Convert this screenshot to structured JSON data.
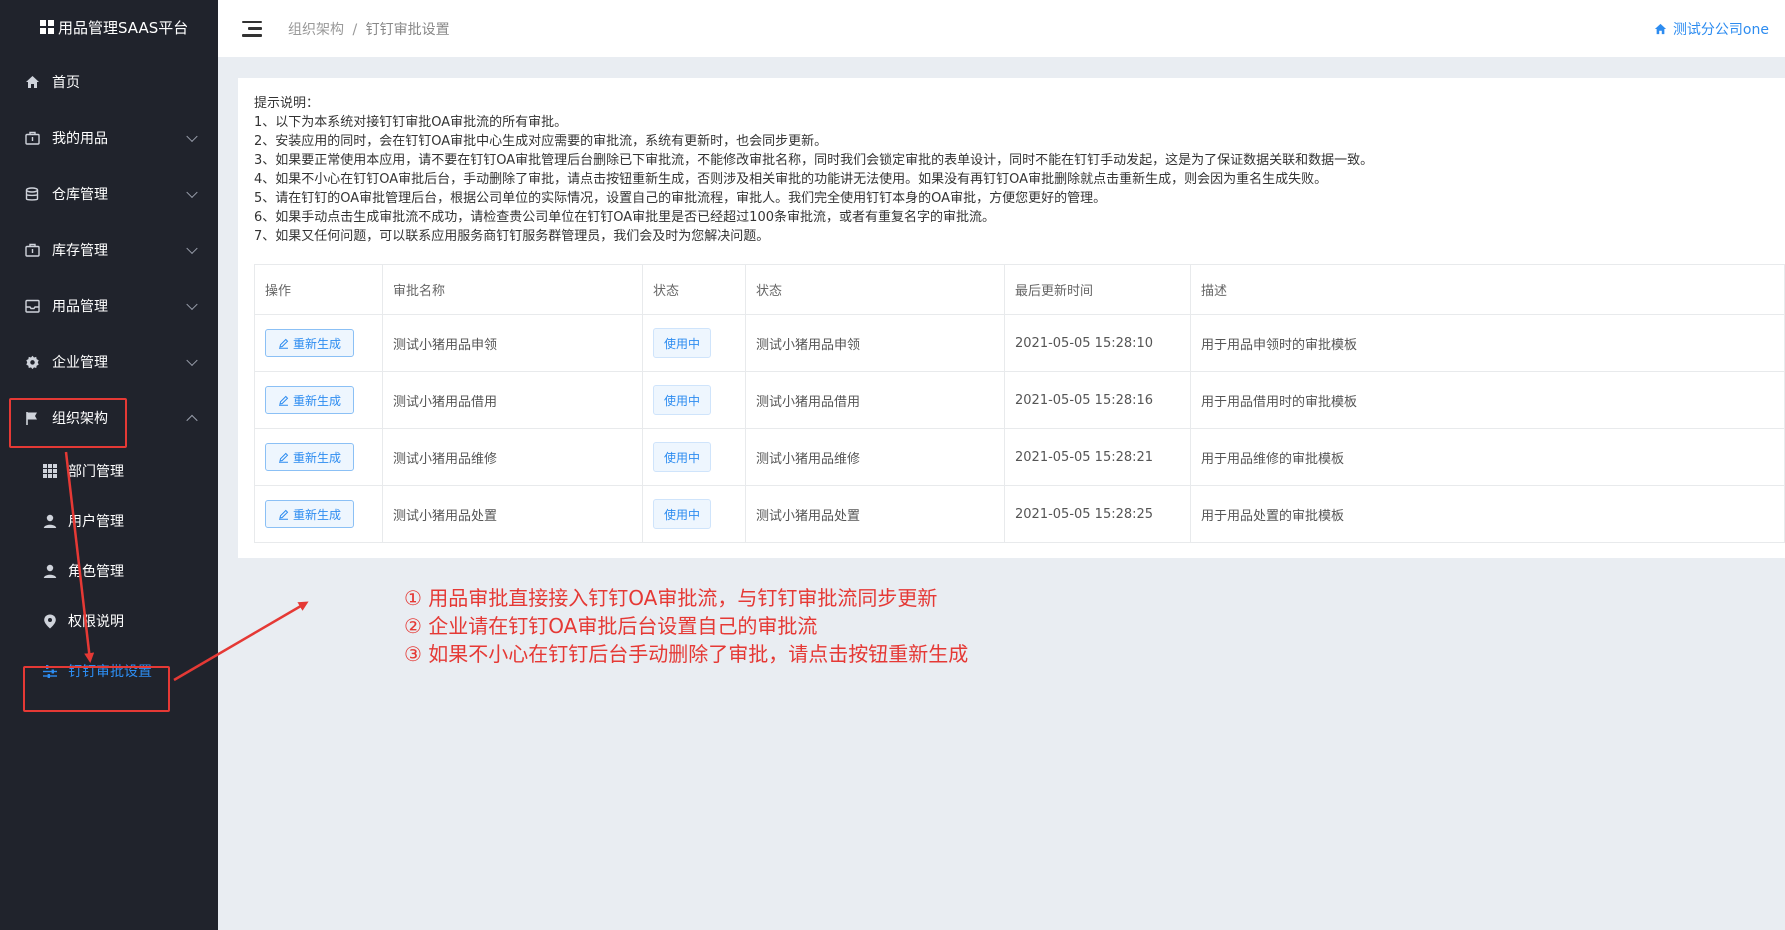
{
  "app": {
    "title": "用品管理SAAS平台"
  },
  "sidebar": {
    "items": [
      {
        "label": "首页",
        "icon": "home-icon"
      },
      {
        "label": "我的用品",
        "icon": "briefcase-icon"
      },
      {
        "label": "仓库管理",
        "icon": "database-icon"
      },
      {
        "label": "库存管理",
        "icon": "briefcase-icon"
      },
      {
        "label": "用品管理",
        "icon": "inbox-icon"
      },
      {
        "label": "企业管理",
        "icon": "gear-icon"
      },
      {
        "label": "组织架构",
        "icon": "flag-icon"
      }
    ],
    "submenu": [
      {
        "label": "部门管理",
        "icon": "grid-icon"
      },
      {
        "label": "用户管理",
        "icon": "user-icon"
      },
      {
        "label": "角色管理",
        "icon": "user-icon"
      },
      {
        "label": "权限说明",
        "icon": "location-icon"
      },
      {
        "label": "钉钉审批设置",
        "icon": "sliders-icon"
      }
    ]
  },
  "header": {
    "breadcrumb": [
      "组织架构",
      "钉钉审批设置"
    ],
    "separator": "/",
    "company": "测试分公司one"
  },
  "notes": {
    "title": "提示说明：",
    "lines": [
      "1、以下为本系统对接钉钉审批OA审批流的所有审批。",
      "2、安装应用的同时，会在钉钉OA审批中心生成对应需要的审批流，系统有更新时，也会同步更新。",
      "3、如果要正常使用本应用，请不要在钉钉OA审批管理后台删除已下审批流，不能修改审批名称，同时我们会锁定审批的表单设计，同时不能在钉钉手动发起，这是为了保证数据关联和数据一致。",
      "4、如果不小心在钉钉OA审批后台，手动删除了审批，请点击按钮重新生成，否则涉及相关审批的功能讲无法使用。如果没有再钉钉OA审批删除就点击重新生成，则会因为重名生成失败。",
      "5、请在钉钉的OA审批管理后台，根据公司单位的实际情况，设置自己的审批流程，审批人。我们完全使用钉钉本身的OA审批，方便您更好的管理。",
      "6、如果手动点击生成审批流不成功，请检查贵公司单位在钉钉OA审批里是否已经超过100条审批流，或者有重复名字的审批流。",
      "7、如果又任何问题，可以联系应用服务商钉钉服务群管理员，我们会及时为您解决问题。"
    ]
  },
  "table": {
    "headers": [
      "操作",
      "审批名称",
      "状态",
      "状态",
      "最后更新时间",
      "描述"
    ],
    "action_label": "重新生成",
    "rows": [
      {
        "name": "测试小猪用品申领",
        "status": "使用中",
        "status2": "测试小猪用品申领",
        "updated": "2021-05-05 15:28:10",
        "desc": "用于用品申领时的审批模板"
      },
      {
        "name": "测试小猪用品借用",
        "status": "使用中",
        "status2": "测试小猪用品借用",
        "updated": "2021-05-05 15:28:16",
        "desc": "用于用品借用时的审批模板"
      },
      {
        "name": "测试小猪用品维修",
        "status": "使用中",
        "status2": "测试小猪用品维修",
        "updated": "2021-05-05 15:28:21",
        "desc": "用于用品维修的审批模板"
      },
      {
        "name": "测试小猪用品处置",
        "status": "使用中",
        "status2": "测试小猪用品处置",
        "updated": "2021-05-05 15:28:25",
        "desc": "用于用品处置的审批模板"
      }
    ]
  },
  "annotation": {
    "lines": [
      "① 用品审批直接接入钉钉OA审批流，与钉钉审批流同步更新",
      "② 企业请在钉钉OA审批后台设置自己的审批流",
      "③ 如果不小心在钉钉后台手动删除了审批，请点击按钮重新生成"
    ]
  },
  "colors": {
    "sidebar_bg": "#20232c",
    "accent": "#2d8cf0",
    "annotation": "#e53935"
  }
}
